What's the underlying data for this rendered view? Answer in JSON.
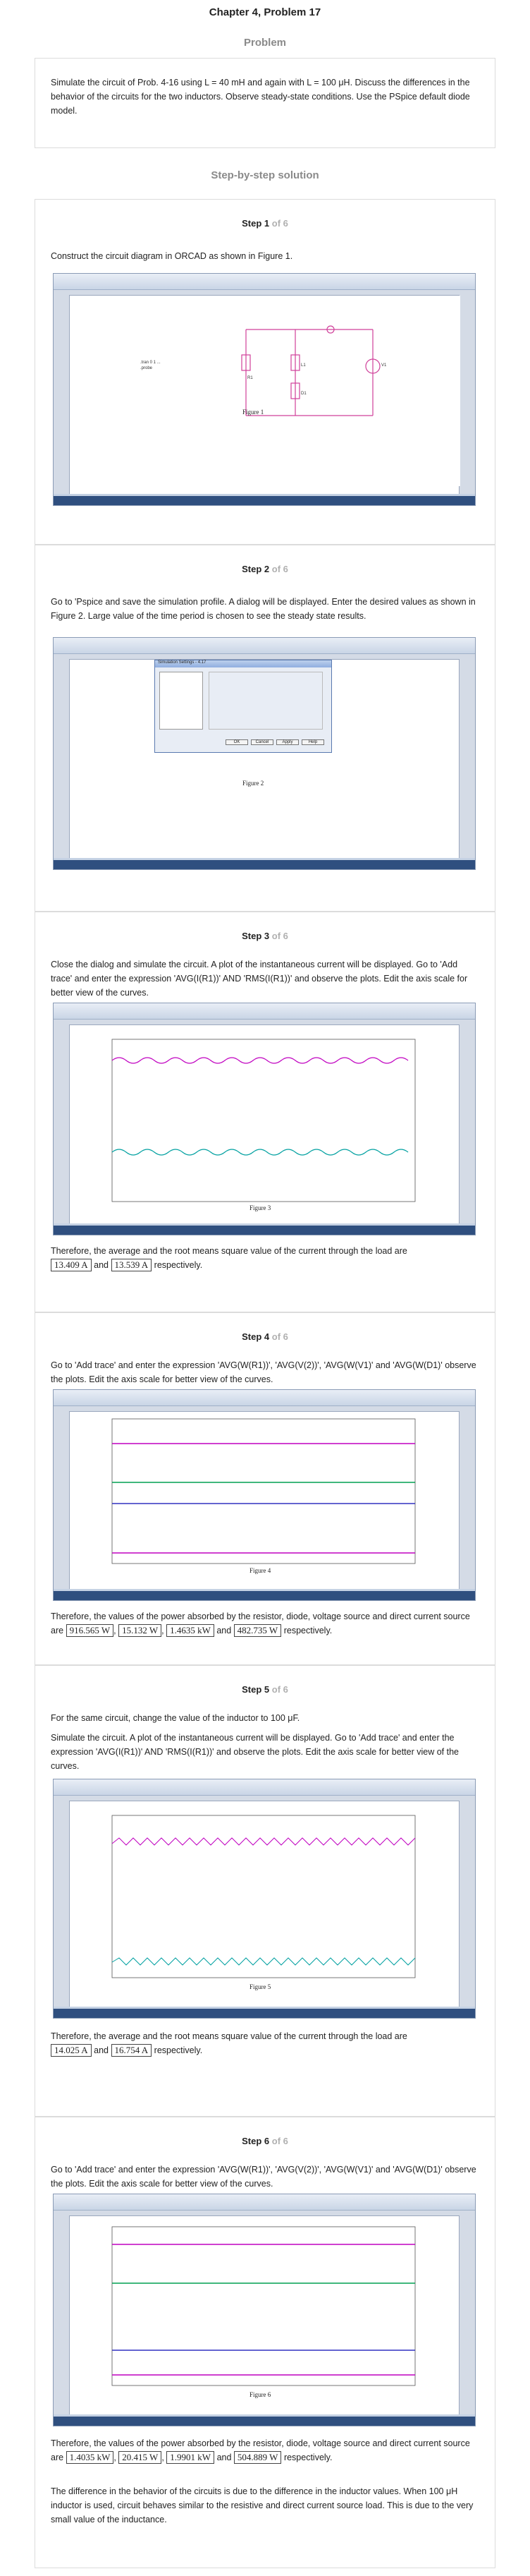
{
  "chapter_title": "Chapter 4, Problem 17",
  "problem_label": "Problem",
  "problem_text": "Simulate the circuit of Prob. 4-16 using L = 40 mH and again with L = 100 μH. Discuss the differences in the behavior of the circuits for the two inductors. Observe steady-state conditions. Use the PSpice default diode model.",
  "solution_label": "Step-by-step solution",
  "steps": [
    {
      "title": "Step 1",
      "of": "of 6",
      "text": "Construct the circuit diagram in ORCAD as shown in Figure 1.",
      "figure_caption": "Figure 1"
    },
    {
      "title": "Step 2",
      "of": "of 6",
      "text": "Go to 'Pspice and save the simulation profile. A dialog will be displayed. Enter the desired values as shown in Figure 2. Large value of the time period is chosen to see the steady state results.",
      "figure_caption": "Figure 2",
      "dialog_title": "Simulation Settings - 4.17",
      "dialog_buttons": [
        "OK",
        "Cancel",
        "Apply",
        "Help"
      ]
    },
    {
      "title": "Step 3",
      "of": "of 6",
      "text": "Close the dialog and simulate the circuit. A plot of the instantaneous current will be displayed. Go to 'Add trace' and enter the expression 'AVG(I(R1))' AND 'RMS(I(R1))' and observe the plots. Edit the axis scale for better view of the curves.",
      "figure_caption": "Figure 3",
      "result_prefix": "Therefore, the average and the root means square value of the current through the load are",
      "values": [
        "13.409 A",
        "13.539 A"
      ],
      "joiner": "and",
      "result_suffix": "respectively."
    },
    {
      "title": "Step 4",
      "of": "of 6",
      "text": "Go to 'Add trace' and enter the expression 'AVG(W(R1))', 'AVG(V(2))', 'AVG(W(V1)' and 'AVG(W(D1)' observe the plots. Edit the axis scale for better view of the curves.",
      "figure_caption": "Figure 4",
      "result_prefix": "Therefore, the values of the power absorbed by the resistor, diode, voltage source and direct current source are",
      "values": [
        "916.565 W",
        "15.132 W",
        "1.4635 kW",
        "482.735 W"
      ],
      "joiner": "and",
      "result_suffix": "respectively."
    },
    {
      "title": "Step 5",
      "of": "of 6",
      "text_a": "For the same circuit, change the value of the inductor to 100 μF.",
      "text_b": "Simulate the circuit. A plot of the instantaneous current will be displayed. Go to 'Add trace' and enter the expression 'AVG(I(R1))' AND 'RMS(I(R1))' and observe the plots. Edit the axis scale for better view of the curves.",
      "figure_caption": "Figure 5",
      "result_prefix": "Therefore, the average and the root means square value of the current through the load are",
      "values": [
        "14.025 A",
        "16.754 A"
      ],
      "joiner": "and",
      "result_suffix": "respectively."
    },
    {
      "title": "Step 6",
      "of": "of 6",
      "text": "Go to 'Add trace' and enter the expression 'AVG(W(R1))', 'AVG(V(2))', 'AVG(W(V1)' and 'AVG(W(D1)' observe the plots. Edit the axis scale for better view of the curves.",
      "figure_caption": "Figure 6",
      "result_prefix": "Therefore, the values of the power absorbed by the resistor, diode, voltage source and direct current source are",
      "values": [
        "1.4035 kW",
        "20.415 W",
        "1.9901 kW",
        "504.889 W"
      ],
      "joiner": "and",
      "result_suffix": "respectively.",
      "conclusion": "The difference in the behavior of the circuits is due to the difference in the inductor values. When 100 μH inductor is used, circuit behaves similar to the resistive and direct current source load. This is due to the very small value of the inductance."
    }
  ],
  "colors": {
    "card_border": "#dcdcdc",
    "muted": "#8a8a8a",
    "trace_magenta": "#c000c0",
    "trace_teal": "#00a0a0",
    "trace_blue": "#3030c0",
    "trace_green": "#00a050"
  }
}
